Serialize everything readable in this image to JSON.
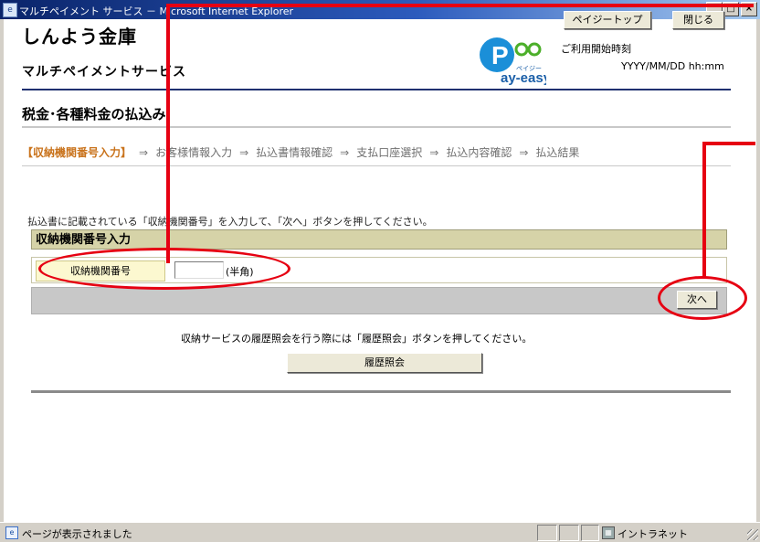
{
  "window": {
    "title": "マルチペイメント サービス － Microsoft Internet Explorer",
    "minimize_glyph": "_",
    "maximize_glyph": "□",
    "close_glyph": "×"
  },
  "header": {
    "bank_name": "しんよう金庫",
    "service_name": "マルチペイメントサービス",
    "logo_text": "ay-easy",
    "logo_small": "ペイジー",
    "page_top_label": "ペイジートップ",
    "close_label": "閉じる",
    "start_time_label": "ご利用開始時刻",
    "start_time_value": "YYYY/MM/DD hh:mm"
  },
  "page": {
    "title": "税金･各種料金の払込み"
  },
  "steps": [
    "【収納機関番号入力】",
    "お客様情報入力",
    "払込書情報確認",
    "支払口座選択",
    "払込内容確認",
    "払込結果"
  ],
  "steps_arrow": "⇒",
  "form": {
    "instruction": "払込書に記載されている「収納機関番号」を入力して、「次へ」ボタンを押してください。",
    "section_title": "収納機関番号入力",
    "field_label": "収納機関番号",
    "field_value": "",
    "field_note": "(半角)",
    "next_label": "次へ"
  },
  "history": {
    "text": "収納サービスの履歴照会を行う際には「履歴照会」ボタンを押してください。",
    "button_label": "履歴照会"
  },
  "statusbar": {
    "text": "ページが表示されました",
    "zone": "イントラネット"
  },
  "colors": {
    "annotation": "#e60012",
    "current_step": "#c9731c",
    "header_rule": "#1f3070",
    "section_header_bg": "#d6d3a8"
  }
}
